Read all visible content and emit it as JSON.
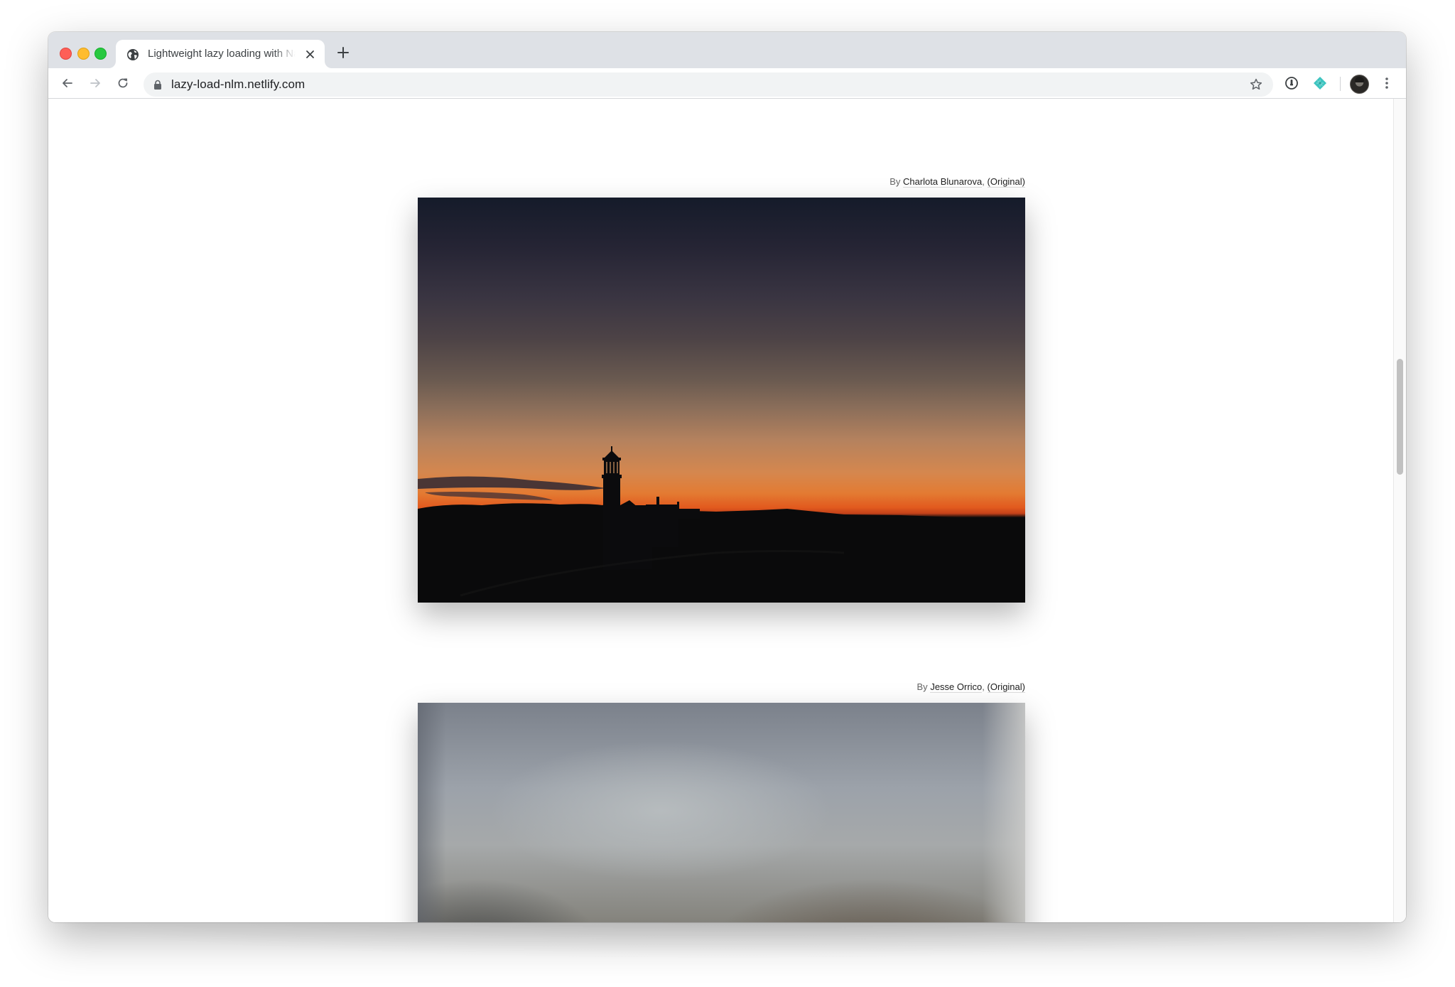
{
  "browser": {
    "window_controls": [
      "close",
      "minimize",
      "zoom"
    ],
    "tabs": [
      {
        "title": "Lightweight lazy loading with Native Lazy Loading",
        "favicon": "globe-icon",
        "active": true
      }
    ],
    "new_tab_label": "+",
    "toolbar": {
      "back": "arrow-left-icon",
      "forward": "arrow-right-icon",
      "reload": "reload-icon",
      "url": "lazy-load-nlm.netlify.com",
      "secure": true,
      "bookmark": "star-icon",
      "extensions": [
        "1password-icon",
        "netlify-icon"
      ],
      "profile": "avatar",
      "menu": "kebab-menu-icon"
    },
    "scrollbar": {
      "position_fraction": 0.43,
      "thumb_fraction": 0.14
    }
  },
  "page": {
    "figures": [
      {
        "by_label": "By",
        "author": "Charlota Blunarova",
        "separator": ",",
        "original_label": "(Original)",
        "image_alt": "Lighthouse silhouette at sunset",
        "state": "loaded"
      },
      {
        "by_label": "By",
        "author": "Jesse Orrico",
        "separator": ",",
        "original_label": "(Original)",
        "image_alt": "Blurred placeholder image",
        "state": "placeholder-blurred"
      }
    ]
  },
  "colors": {
    "tabstrip_bg": "#dee1e6",
    "omnibox_bg": "#f1f3f4",
    "traffic_red": "#fe5f57",
    "traffic_yellow": "#febc2e",
    "traffic_green": "#28c840",
    "netlify_teal": "#3dc4c0"
  }
}
